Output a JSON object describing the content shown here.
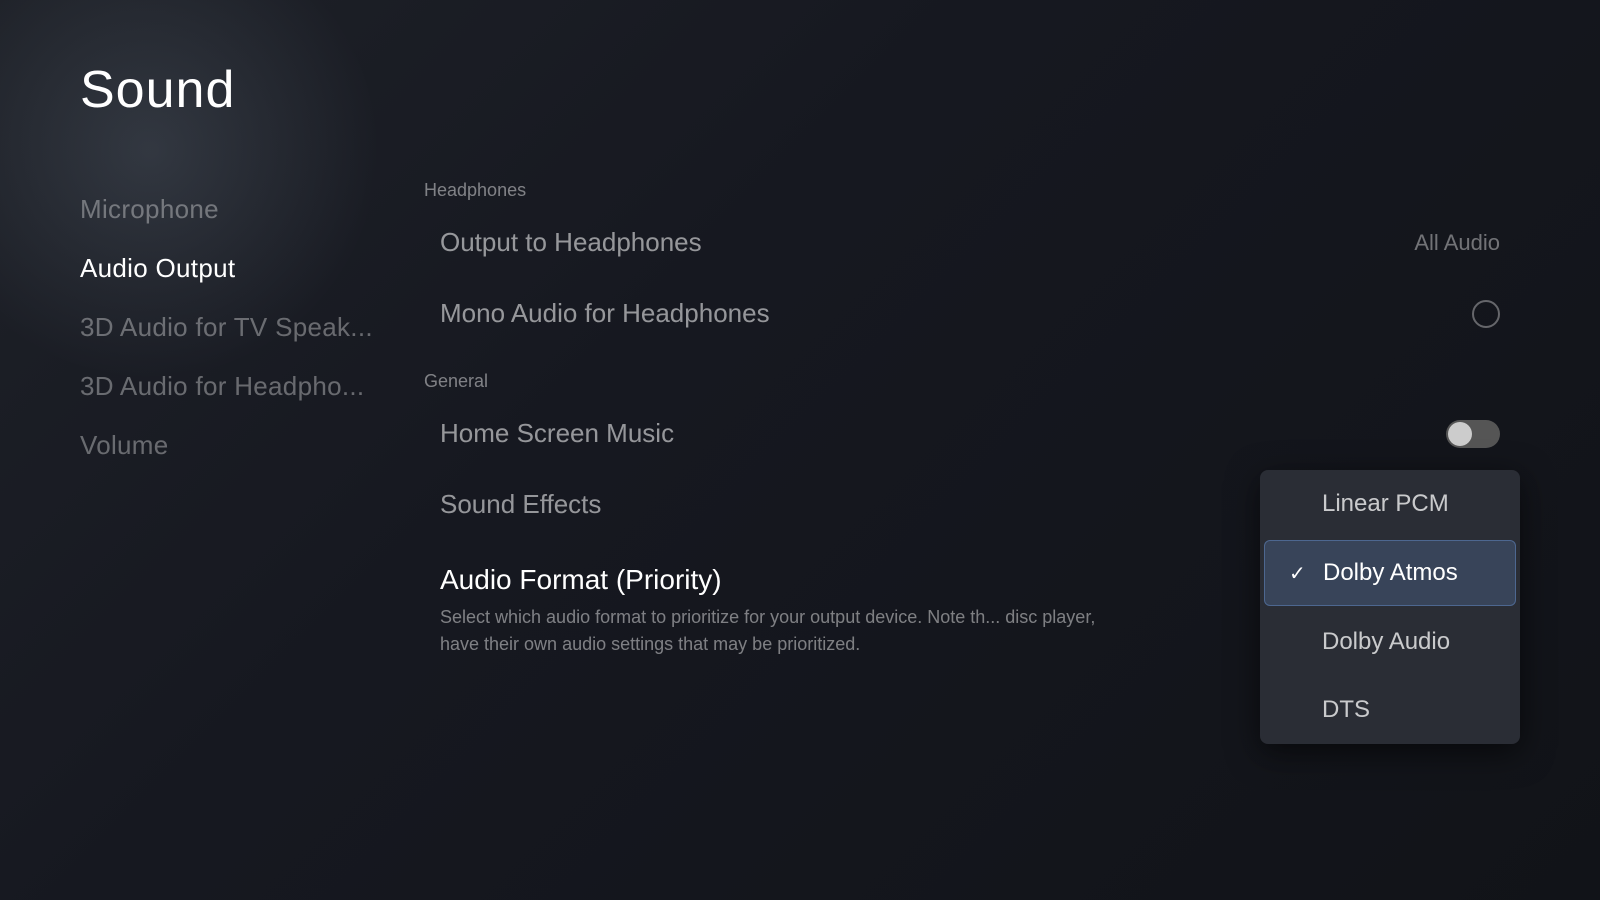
{
  "page": {
    "title": "Sound"
  },
  "sidebar": {
    "items": [
      {
        "id": "microphone",
        "label": "Microphone",
        "active": false
      },
      {
        "id": "audio-output",
        "label": "Audio Output",
        "active": true
      },
      {
        "id": "3d-tv",
        "label": "3D Audio for TV Speak...",
        "active": false
      },
      {
        "id": "3d-headphones",
        "label": "3D Audio for Headpho...",
        "active": false
      },
      {
        "id": "volume",
        "label": "Volume",
        "active": false
      }
    ]
  },
  "main": {
    "sections": {
      "headphones": {
        "label": "Headphones",
        "items": [
          {
            "id": "output-to-headphones",
            "label": "Output to Headphones",
            "value": "All Audio",
            "type": "value"
          },
          {
            "id": "mono-audio",
            "label": "Mono Audio for Headphones",
            "value": "",
            "type": "toggle-circle"
          }
        ]
      },
      "general": {
        "label": "General",
        "items": [
          {
            "id": "home-screen-music",
            "label": "Home Screen Music",
            "type": "toggle",
            "on": false
          },
          {
            "id": "sound-effects",
            "label": "Sound Effects",
            "type": "none"
          }
        ]
      },
      "audio-format": {
        "title": "Audio Format (Priority)",
        "description": "Select which audio format to prioritize for your output device. Note th... disc player, have their own audio settings that may be prioritized."
      }
    },
    "dropdown": {
      "items": [
        {
          "id": "linear-pcm",
          "label": "Linear PCM",
          "selected": false
        },
        {
          "id": "dolby-atmos",
          "label": "Dolby Atmos",
          "selected": true
        },
        {
          "id": "dolby-audio",
          "label": "Dolby Audio",
          "selected": false
        },
        {
          "id": "dts",
          "label": "DTS",
          "selected": false
        }
      ]
    }
  }
}
